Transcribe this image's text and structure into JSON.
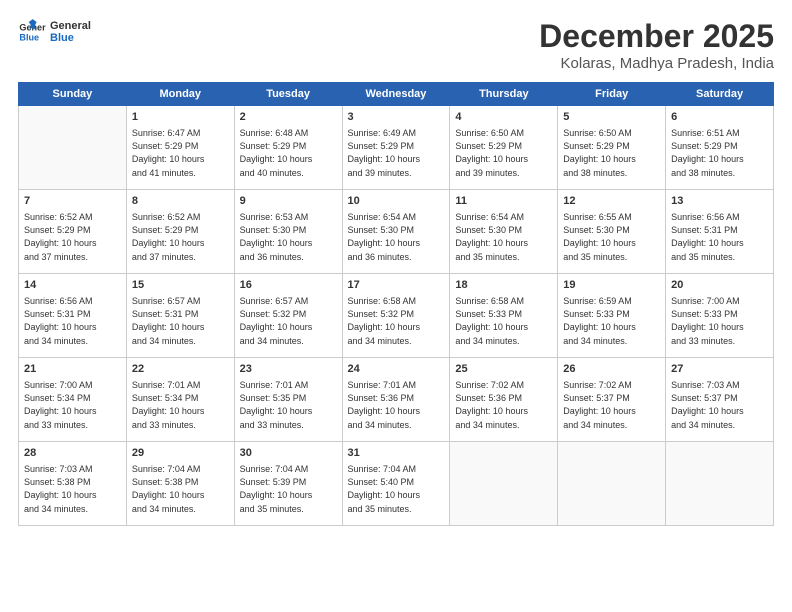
{
  "header": {
    "logo_line1": "General",
    "logo_line2": "Blue",
    "title": "December 2025",
    "subtitle": "Kolaras, Madhya Pradesh, India"
  },
  "weekdays": [
    "Sunday",
    "Monday",
    "Tuesday",
    "Wednesday",
    "Thursday",
    "Friday",
    "Saturday"
  ],
  "weeks": [
    [
      {
        "day": "",
        "info": ""
      },
      {
        "day": "1",
        "info": "Sunrise: 6:47 AM\nSunset: 5:29 PM\nDaylight: 10 hours\nand 41 minutes."
      },
      {
        "day": "2",
        "info": "Sunrise: 6:48 AM\nSunset: 5:29 PM\nDaylight: 10 hours\nand 40 minutes."
      },
      {
        "day": "3",
        "info": "Sunrise: 6:49 AM\nSunset: 5:29 PM\nDaylight: 10 hours\nand 39 minutes."
      },
      {
        "day": "4",
        "info": "Sunrise: 6:50 AM\nSunset: 5:29 PM\nDaylight: 10 hours\nand 39 minutes."
      },
      {
        "day": "5",
        "info": "Sunrise: 6:50 AM\nSunset: 5:29 PM\nDaylight: 10 hours\nand 38 minutes."
      },
      {
        "day": "6",
        "info": "Sunrise: 6:51 AM\nSunset: 5:29 PM\nDaylight: 10 hours\nand 38 minutes."
      }
    ],
    [
      {
        "day": "7",
        "info": "Sunrise: 6:52 AM\nSunset: 5:29 PM\nDaylight: 10 hours\nand 37 minutes."
      },
      {
        "day": "8",
        "info": "Sunrise: 6:52 AM\nSunset: 5:29 PM\nDaylight: 10 hours\nand 37 minutes."
      },
      {
        "day": "9",
        "info": "Sunrise: 6:53 AM\nSunset: 5:30 PM\nDaylight: 10 hours\nand 36 minutes."
      },
      {
        "day": "10",
        "info": "Sunrise: 6:54 AM\nSunset: 5:30 PM\nDaylight: 10 hours\nand 36 minutes."
      },
      {
        "day": "11",
        "info": "Sunrise: 6:54 AM\nSunset: 5:30 PM\nDaylight: 10 hours\nand 35 minutes."
      },
      {
        "day": "12",
        "info": "Sunrise: 6:55 AM\nSunset: 5:30 PM\nDaylight: 10 hours\nand 35 minutes."
      },
      {
        "day": "13",
        "info": "Sunrise: 6:56 AM\nSunset: 5:31 PM\nDaylight: 10 hours\nand 35 minutes."
      }
    ],
    [
      {
        "day": "14",
        "info": "Sunrise: 6:56 AM\nSunset: 5:31 PM\nDaylight: 10 hours\nand 34 minutes."
      },
      {
        "day": "15",
        "info": "Sunrise: 6:57 AM\nSunset: 5:31 PM\nDaylight: 10 hours\nand 34 minutes."
      },
      {
        "day": "16",
        "info": "Sunrise: 6:57 AM\nSunset: 5:32 PM\nDaylight: 10 hours\nand 34 minutes."
      },
      {
        "day": "17",
        "info": "Sunrise: 6:58 AM\nSunset: 5:32 PM\nDaylight: 10 hours\nand 34 minutes."
      },
      {
        "day": "18",
        "info": "Sunrise: 6:58 AM\nSunset: 5:33 PM\nDaylight: 10 hours\nand 34 minutes."
      },
      {
        "day": "19",
        "info": "Sunrise: 6:59 AM\nSunset: 5:33 PM\nDaylight: 10 hours\nand 34 minutes."
      },
      {
        "day": "20",
        "info": "Sunrise: 7:00 AM\nSunset: 5:33 PM\nDaylight: 10 hours\nand 33 minutes."
      }
    ],
    [
      {
        "day": "21",
        "info": "Sunrise: 7:00 AM\nSunset: 5:34 PM\nDaylight: 10 hours\nand 33 minutes."
      },
      {
        "day": "22",
        "info": "Sunrise: 7:01 AM\nSunset: 5:34 PM\nDaylight: 10 hours\nand 33 minutes."
      },
      {
        "day": "23",
        "info": "Sunrise: 7:01 AM\nSunset: 5:35 PM\nDaylight: 10 hours\nand 33 minutes."
      },
      {
        "day": "24",
        "info": "Sunrise: 7:01 AM\nSunset: 5:36 PM\nDaylight: 10 hours\nand 34 minutes."
      },
      {
        "day": "25",
        "info": "Sunrise: 7:02 AM\nSunset: 5:36 PM\nDaylight: 10 hours\nand 34 minutes."
      },
      {
        "day": "26",
        "info": "Sunrise: 7:02 AM\nSunset: 5:37 PM\nDaylight: 10 hours\nand 34 minutes."
      },
      {
        "day": "27",
        "info": "Sunrise: 7:03 AM\nSunset: 5:37 PM\nDaylight: 10 hours\nand 34 minutes."
      }
    ],
    [
      {
        "day": "28",
        "info": "Sunrise: 7:03 AM\nSunset: 5:38 PM\nDaylight: 10 hours\nand 34 minutes."
      },
      {
        "day": "29",
        "info": "Sunrise: 7:04 AM\nSunset: 5:38 PM\nDaylight: 10 hours\nand 34 minutes."
      },
      {
        "day": "30",
        "info": "Sunrise: 7:04 AM\nSunset: 5:39 PM\nDaylight: 10 hours\nand 35 minutes."
      },
      {
        "day": "31",
        "info": "Sunrise: 7:04 AM\nSunset: 5:40 PM\nDaylight: 10 hours\nand 35 minutes."
      },
      {
        "day": "",
        "info": ""
      },
      {
        "day": "",
        "info": ""
      },
      {
        "day": "",
        "info": ""
      }
    ]
  ]
}
